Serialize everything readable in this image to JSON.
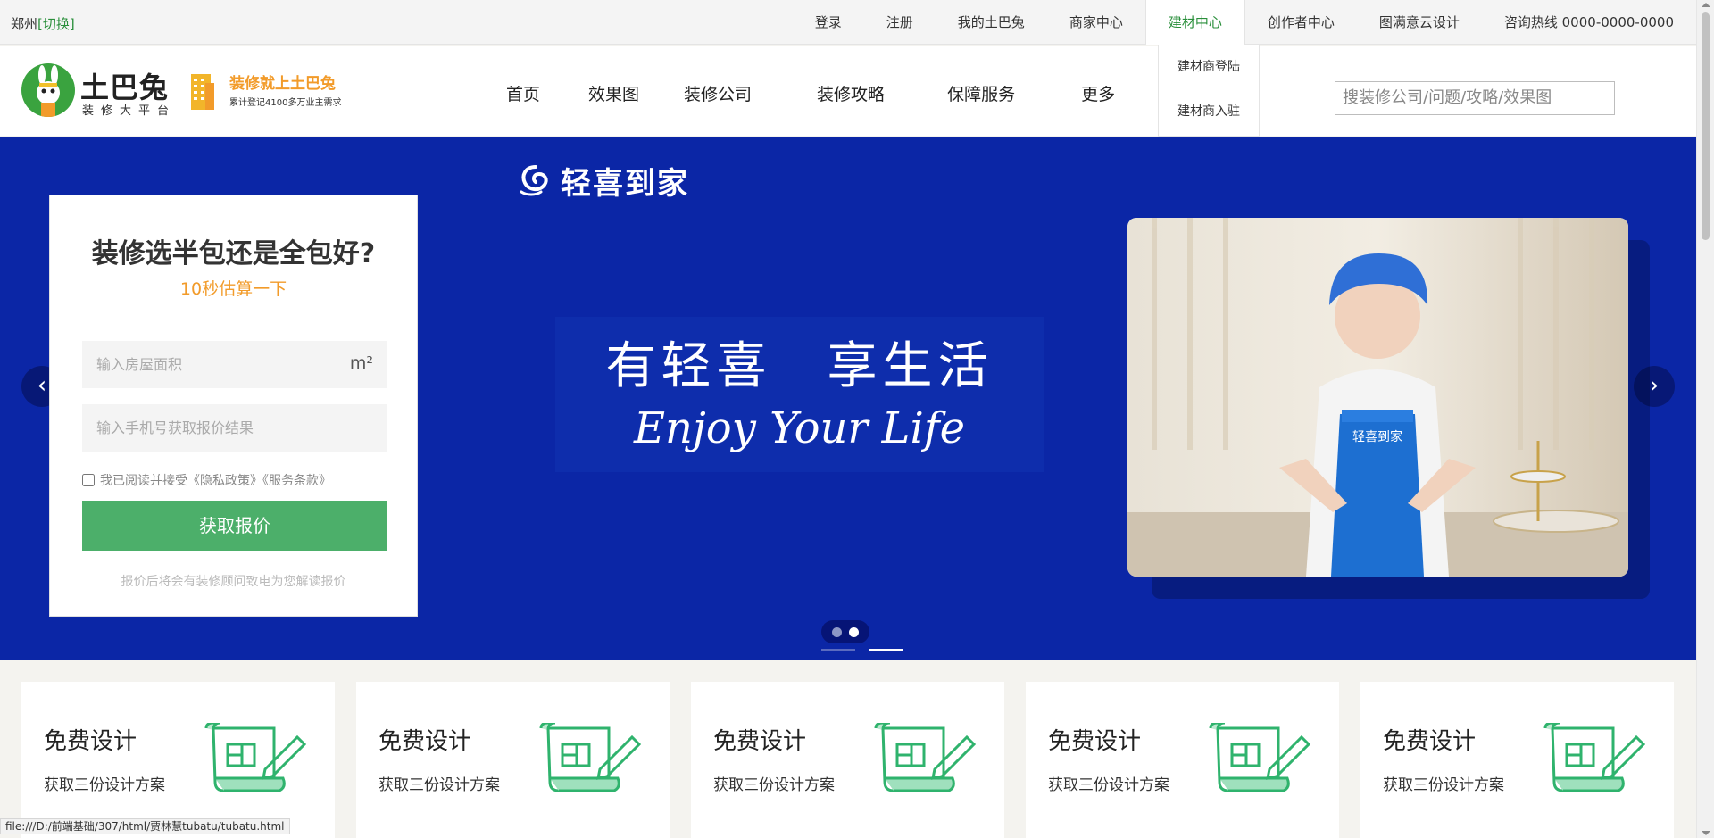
{
  "topbar": {
    "city": "郑州",
    "switch_label": "[切换]",
    "links": [
      "登录",
      "注册",
      "我的土巴兔",
      "商家中心",
      "建材中心",
      "创作者中心",
      "图满意云设计",
      "咨询热线 0000-0000-0000"
    ],
    "active_index": 4,
    "dropdown": [
      "建材商登陆",
      "建材商入驻"
    ]
  },
  "header": {
    "logo_name": "土巴兔",
    "logo_sub": "装修大平台",
    "slogan_title": "装修就上土巴兔",
    "slogan_sub": "累计登记4100多万业主需求",
    "nav": [
      "首页",
      "效果图",
      "装修公司",
      "装修攻略",
      "保障服务",
      "更多"
    ],
    "search_placeholder": "搜装修公司/问题/攻略/效果图"
  },
  "banner": {
    "brand": "轻喜到家",
    "slogan_cn": "有轻喜　享生活",
    "slogan_en": "Enjoy Your Life",
    "apron_text": "轻喜到家",
    "prev_icon": "chevron-left-icon",
    "next_icon": "chevron-right-icon",
    "slide_count": 2,
    "active_slide": 1,
    "background": "#0b26a6"
  },
  "form": {
    "title": "装修选半包还是全包好?",
    "subtitle": "10秒估算一下",
    "area_placeholder": "输入房屋面积",
    "area_unit": "m²",
    "phone_placeholder": "输入手机号获取报价结果",
    "agree_text": "我已阅读并接受《隐私政策》《服务条款》",
    "submit_label": "获取报价",
    "note": "报价后将会有装修顾问致电为您解读报价",
    "button_color": "#4caf6a"
  },
  "cards": [
    {
      "title": "免费设计",
      "subtitle": "获取三份设计方案",
      "icon": "design-scroll-icon"
    },
    {
      "title": "免费设计",
      "subtitle": "获取三份设计方案",
      "icon": "design-scroll-icon"
    },
    {
      "title": "免费设计",
      "subtitle": "获取三份设计方案",
      "icon": "design-scroll-icon"
    },
    {
      "title": "免费设计",
      "subtitle": "获取三份设计方案",
      "icon": "design-scroll-icon"
    },
    {
      "title": "免费设计",
      "subtitle": "获取三份设计方案",
      "icon": "design-scroll-icon"
    }
  ],
  "statusbar": {
    "url": "file:///D:/前端基础/307/html/贾林慧tubatu/tubatu.html"
  },
  "colors": {
    "accent_green": "#2a8f3b",
    "accent_orange": "#f29b2a"
  }
}
